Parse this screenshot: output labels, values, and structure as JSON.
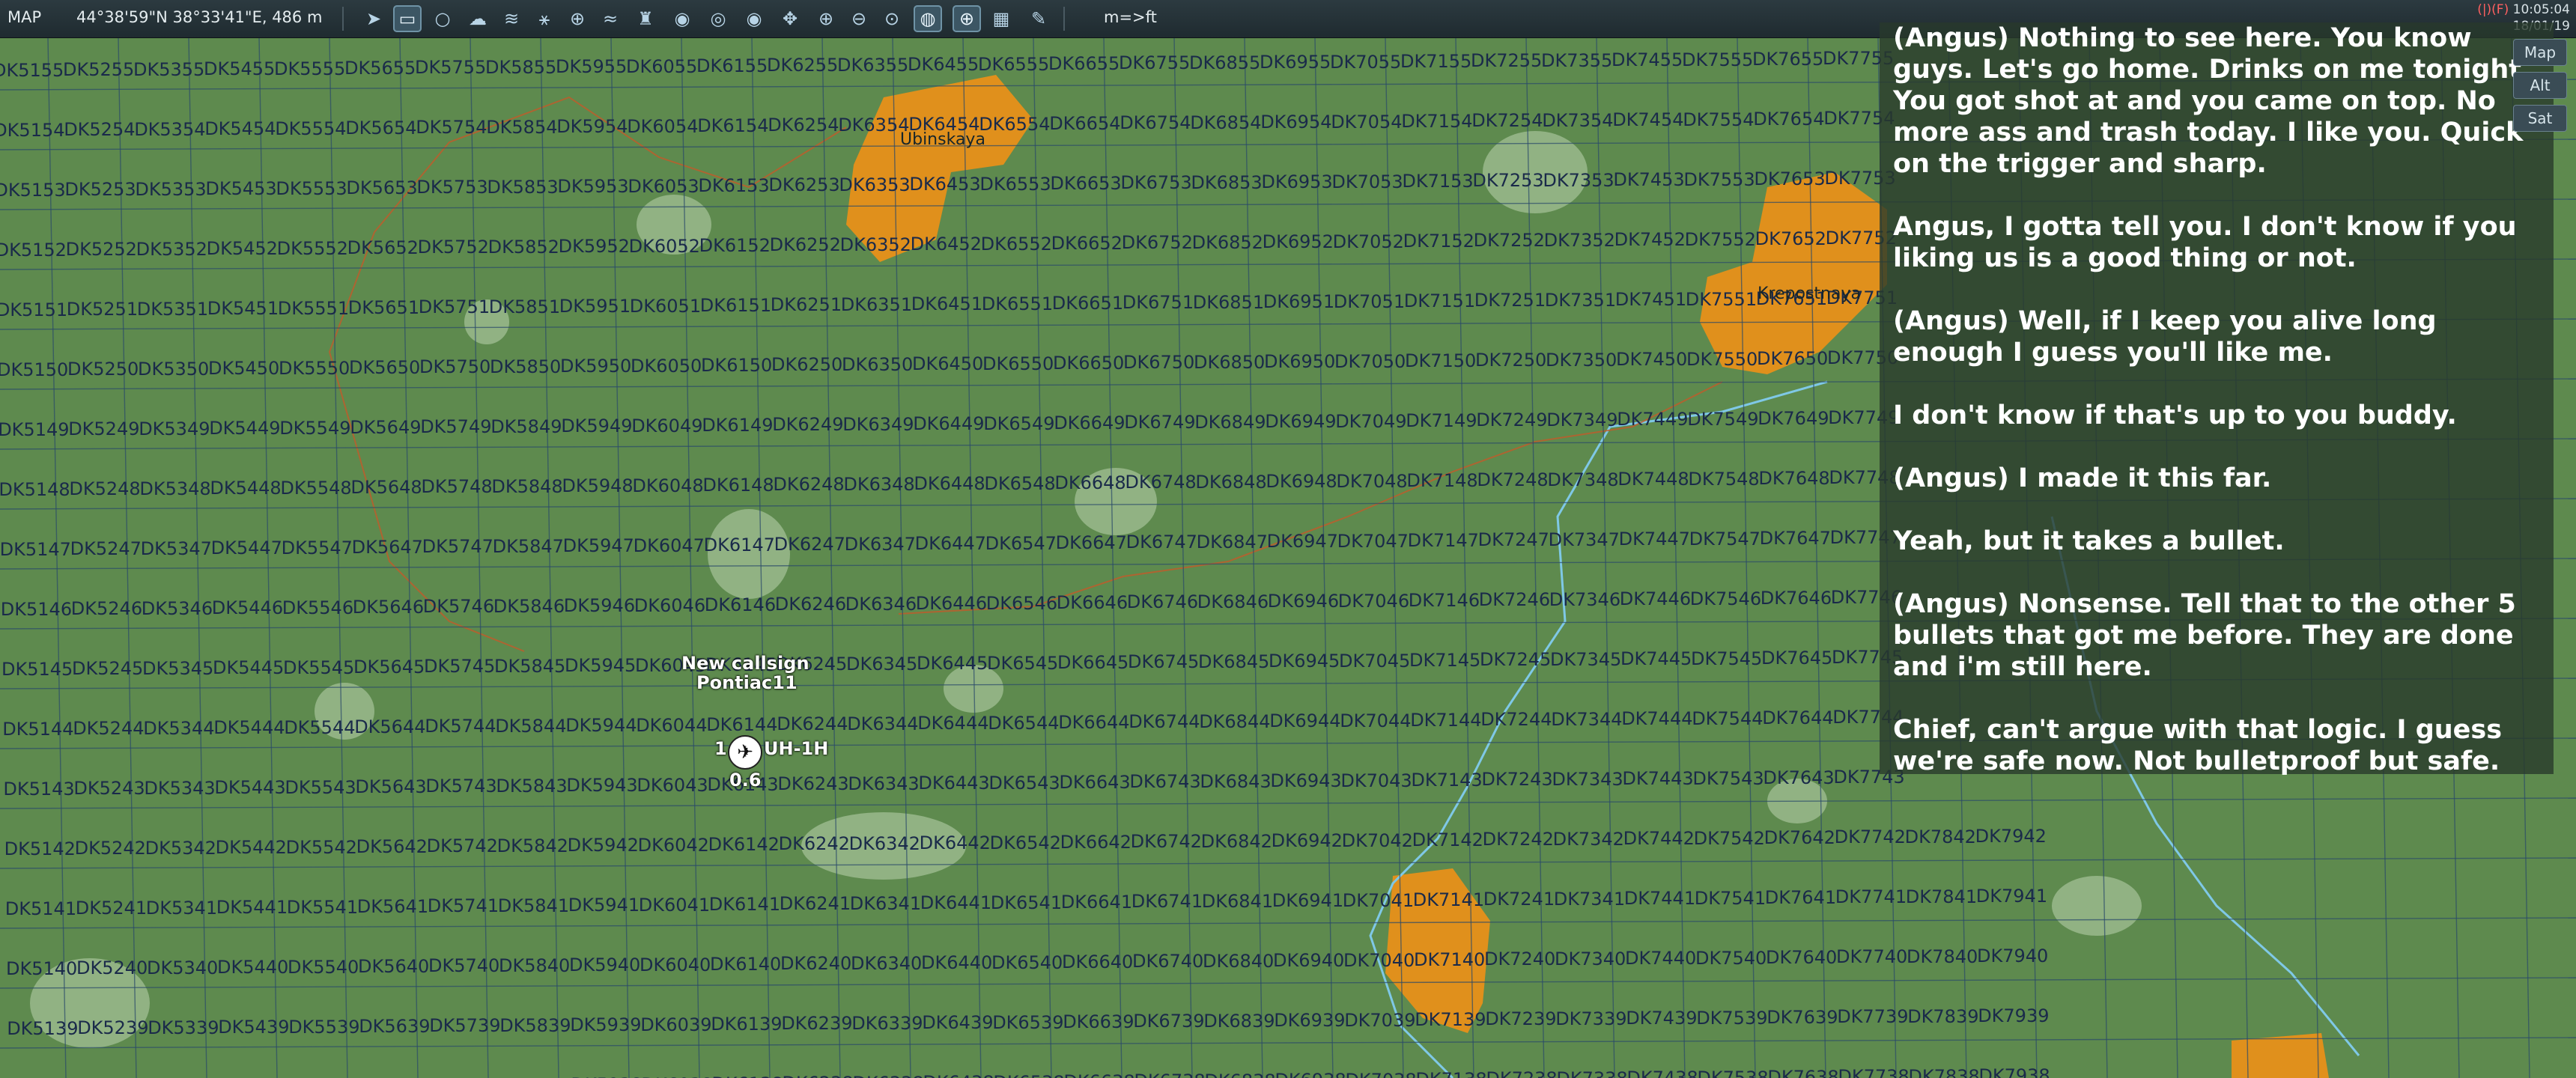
{
  "toolbar": {
    "title": "MAP",
    "coordinates": "44°38'59\"N 38°33'41\"E, 486 m",
    "unit_toggle": "m=>ft",
    "icons": [
      "arrow-cursor-icon",
      "ruler-icon",
      "circle-icon",
      "clouds-icon",
      "wind-icon",
      "network-icon",
      "target-icon",
      "wifi-icon",
      "tower-icon",
      "radar-icon",
      "radar2-icon",
      "radar3-icon",
      "move-icon",
      "zoom-in-icon",
      "zoom-out-icon",
      "zoom-reset-icon",
      "compass-icon",
      "globe-icon",
      "grid-icon",
      "pencil-icon"
    ],
    "clock_time": "10:05:04",
    "clock_date": "18/01/19",
    "flag": "(|)(F)"
  },
  "side_buttons": [
    "Map",
    "Alt",
    "Sat"
  ],
  "subtitles": [
    "(Angus) Nothing to see here. You know guys. Let's go home. Drinks on me tonight. You got shot at and you came on top. No more ass and trash today. I like you. Quick on the trigger and sharp.",
    "Angus, I gotta tell you. I don't know if you liking us is a good thing or not.",
    "(Angus) Well, if I keep you alive long enough I guess you'll like me.",
    "I don't know if that's up to you buddy.",
    "(Angus) I made it this far.",
    "Yeah, but it takes a bullet.",
    "(Angus) Nonsense. Tell that to the other 5 bullets that got me before. They are done and i'm still here.",
    "Chief, can't argue with that logic.  I guess we're safe now. Not bulletproof but safe."
  ],
  "towns": [
    "Ubinskaya",
    "Krepostnaya"
  ],
  "unit": {
    "callsign_line1": "New callsign",
    "callsign_line2": "Pontiac11",
    "group_count": "1",
    "type": "UH-1H",
    "value": "0.6"
  },
  "colors": {
    "terrain": "#5e8a4e",
    "town": "#e0901c",
    "grid_line": "#2a4a6a",
    "river": "#7fc8e6",
    "road": "#c25a2a"
  }
}
